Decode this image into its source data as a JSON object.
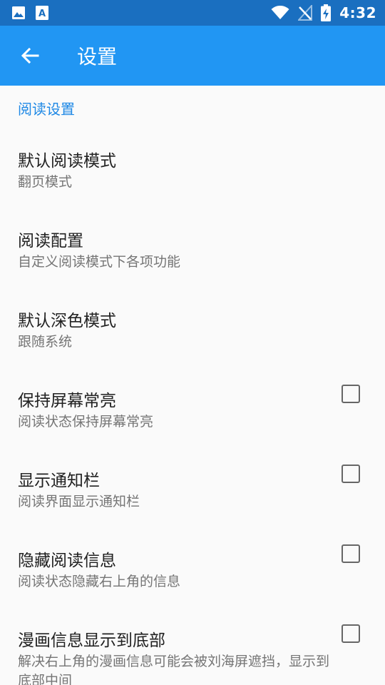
{
  "status_bar": {
    "time": "4:32",
    "left_icons": [
      "image-icon",
      "text-a-icon"
    ],
    "right_icons": [
      "wifi-icon",
      "no-signal-icon",
      "battery-charging-icon"
    ]
  },
  "app_bar": {
    "title": "设置",
    "back_icon": "arrow-left-icon",
    "color": "#2196f3"
  },
  "section": {
    "title": "阅读设置",
    "color": "#1e88e5"
  },
  "preferences": [
    {
      "title": "默认阅读模式",
      "summary": "翻页模式"
    },
    {
      "title": "阅读配置",
      "summary": "自定义阅读模式下各项功能"
    },
    {
      "title": "默认深色模式",
      "summary": "跟随系统"
    },
    {
      "title": "保持屏幕常亮",
      "summary": "阅读状态保持屏幕常亮",
      "checked": false
    },
    {
      "title": "显示通知栏",
      "summary": "阅读界面显示通知栏",
      "checked": false
    },
    {
      "title": "隐藏阅读信息",
      "summary": "阅读状态隐藏右上角的信息",
      "checked": false
    },
    {
      "title": "漫画信息显示到底部",
      "summary": "解决右上角的漫画信息可能会被刘海屏遮挡，显示到底部中间",
      "checked": false
    }
  ]
}
